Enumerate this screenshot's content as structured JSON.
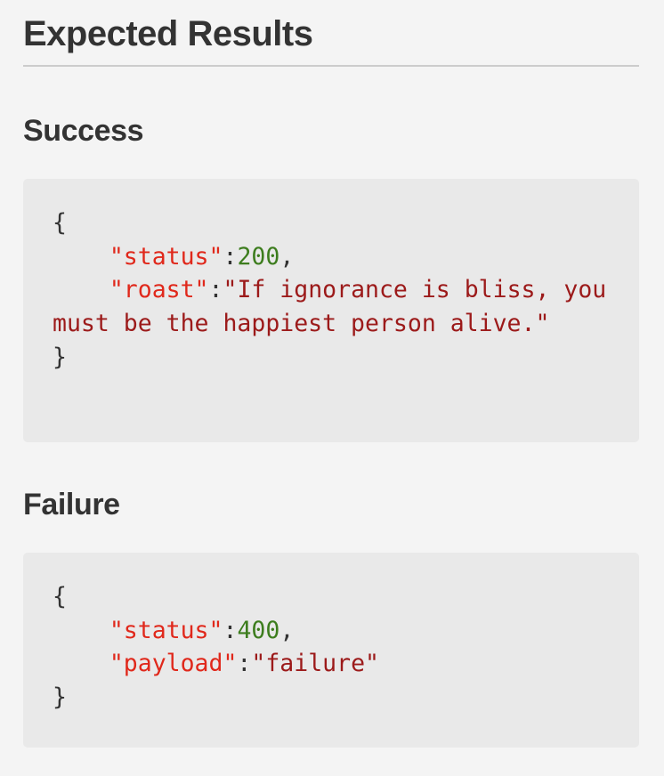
{
  "headings": {
    "main": "Expected Results",
    "success": "Success",
    "failure": "Failure"
  },
  "success_block": {
    "open_brace": "{",
    "indent": "    ",
    "status_key": "\"status\"",
    "colon": ":",
    "status_value": "200",
    "comma": ",",
    "roast_key": "\"roast\"",
    "roast_value": "\"If ignorance is bliss, you must be the happiest person alive.\"",
    "close_brace": "}"
  },
  "failure_block": {
    "open_brace": "{",
    "indent": "    ",
    "status_key": "\"status\"",
    "colon": ":",
    "status_value": "400",
    "comma": ",",
    "payload_key": "\"payload\"",
    "payload_value": "\"failure\"",
    "close_brace": "}"
  },
  "colors": {
    "background": "#f4f4f4",
    "code_background": "#e9e9e9",
    "heading_text": "#333333",
    "json_key": "#e0281b",
    "json_number": "#3d7d1e",
    "json_string": "#9c1a1a",
    "rule": "#cccccc"
  }
}
